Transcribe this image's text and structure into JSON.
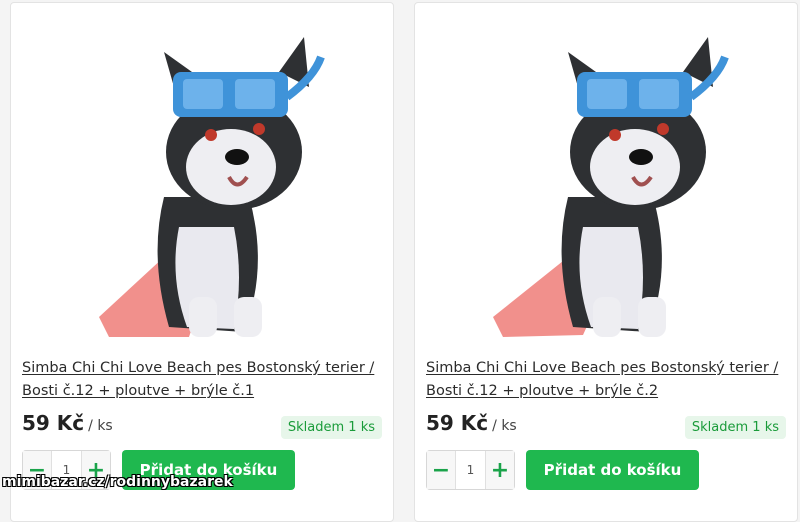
{
  "products": [
    {
      "title": "Simba Chi Chi Love Beach pes Bostonský terier / Bosti č.12 + ploutve + brýle č.1",
      "price": "59 Kč",
      "unit": "/ ks",
      "stock": "Skladem 1 ks",
      "quantity": "1",
      "add_label": "Přidat do košíku"
    },
    {
      "title": "Simba Chi Chi Love Beach pes Bostonský terier / Bosti č.12 + ploutve + brýle č.2",
      "price": "59 Kč",
      "unit": "/ ks",
      "stock": "Skladem 1 ks",
      "quantity": "1",
      "add_label": "Přidat do košíku"
    }
  ],
  "watermark": "mimibazar.cz/rodinnybazarek",
  "colors": {
    "accent_green": "#1fb84f",
    "stock_bg": "#e7f6ea",
    "goggles_blue": "#3f93d9",
    "fin_pink": "#f08a86"
  },
  "icons": {
    "minus": "−",
    "plus": "+"
  }
}
